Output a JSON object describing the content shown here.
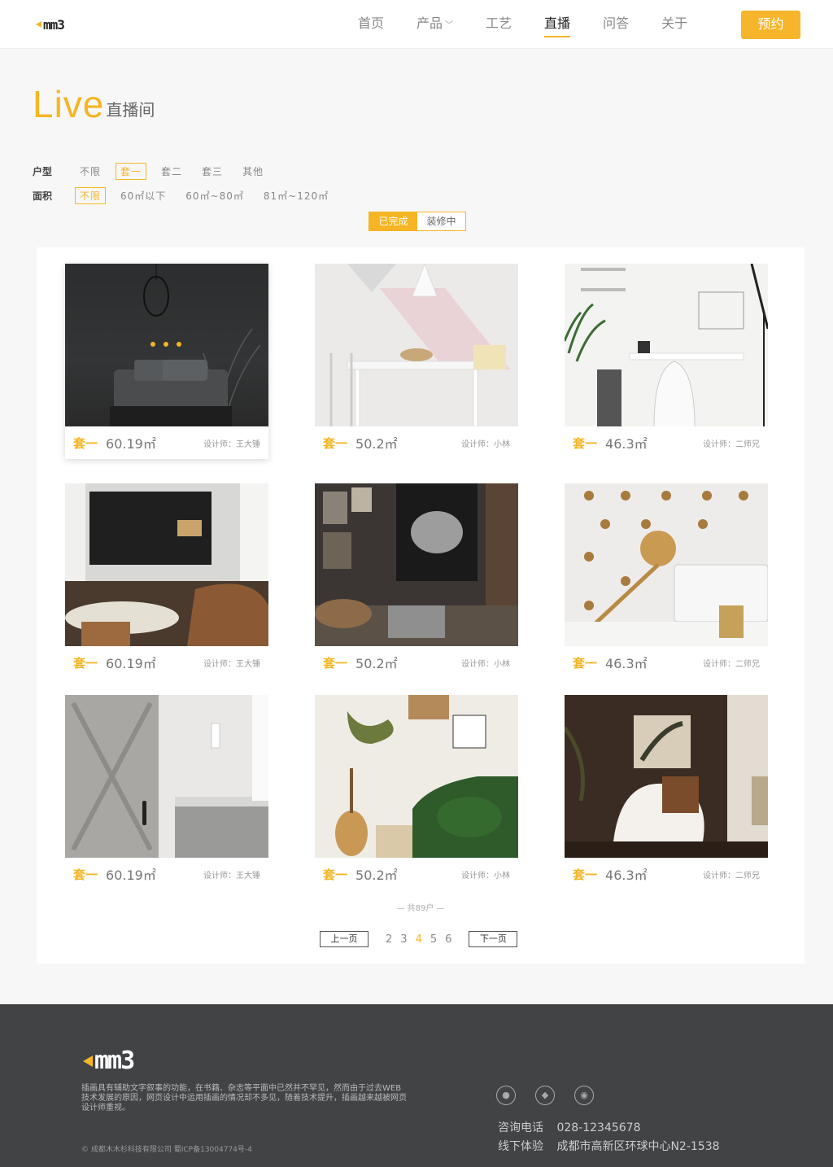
{
  "header": {
    "logo": "mm3",
    "nav": [
      {
        "label": "首页",
        "active": false
      },
      {
        "label": "产品",
        "active": false,
        "dropdown": true
      },
      {
        "label": "工艺",
        "active": false
      },
      {
        "label": "直播",
        "active": true
      },
      {
        "label": "问答",
        "active": false
      },
      {
        "label": "关于",
        "active": false
      }
    ],
    "book_label": "预约"
  },
  "title": {
    "en": "Live",
    "cn": "直播间"
  },
  "filters": {
    "type": {
      "label": "户型",
      "options": [
        "不限",
        "套一",
        "套二",
        "套三",
        "其他"
      ],
      "selected": "套一"
    },
    "area": {
      "label": "面积",
      "options": [
        "不限",
        "60㎡以下",
        "60㎡~80㎡",
        "81㎡~120㎡"
      ],
      "selected": "不限"
    }
  },
  "status": {
    "options": [
      "已完成",
      "装修中"
    ],
    "selected": "已完成"
  },
  "cards": [
    {
      "layout": "套一",
      "area": "60.19㎡",
      "designer": "设计师：王大锤"
    },
    {
      "layout": "套一",
      "area": "50.2㎡",
      "designer": "设计师：小林"
    },
    {
      "layout": "套一",
      "area": "46.3㎡",
      "designer": "设计师：二师兄"
    },
    {
      "layout": "套一",
      "area": "60.19㎡",
      "designer": "设计师：王大锤"
    },
    {
      "layout": "套一",
      "area": "50.2㎡",
      "designer": "设计师：小林"
    },
    {
      "layout": "套一",
      "area": "46.3㎡",
      "designer": "设计师：二师兄"
    },
    {
      "layout": "套一",
      "area": "60.19㎡",
      "designer": "设计师：王大锤"
    },
    {
      "layout": "套一",
      "area": "50.2㎡",
      "designer": "设计师：小林"
    },
    {
      "layout": "套一",
      "area": "46.3㎡",
      "designer": "设计师：二师兄"
    }
  ],
  "pagination": {
    "total": "— 共89户 —",
    "prev": "上一页",
    "next": "下一页",
    "pages": [
      "2",
      "3",
      "4",
      "5",
      "6"
    ],
    "current": "4"
  },
  "footer": {
    "logo": "mm3",
    "description": "插画具有辅助文字叙事的功能，在书籍、杂志等平面中已然并不罕见，然而由于过去WEB技术发展的原因，网页设计中运用插画的情况却不多见，随着技术提升，插画越来越被网页设计师重视。",
    "copyright": "© 成都木木杉科技有限公司 蜀ICP备13004774号-4",
    "icons": [
      "wechat-icon",
      "qq-icon",
      "weibo-icon"
    ],
    "phone_label": "咨询电话",
    "phone": "028-12345678",
    "address_label": "线下体验",
    "address": "成都市高新区环球中心N2-1538"
  },
  "colors": {
    "accent": "#f5b524",
    "footer_bg": "#414345"
  }
}
